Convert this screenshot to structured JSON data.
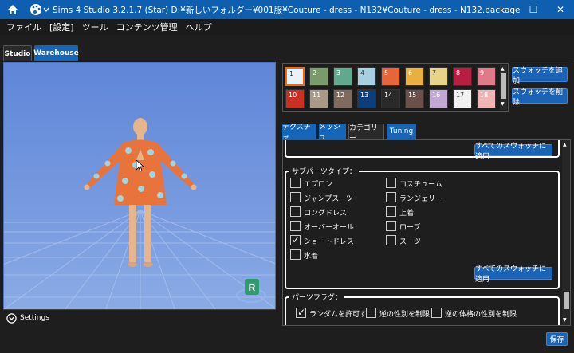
{
  "window": {
    "title": "Sims 4 Studio 3.2.1.7 (Star)  D:¥新しいフォルダー¥001服¥Couture - dress - N132¥Couture - dress - N132.package",
    "min_glyph": "—",
    "max_glyph": "☐",
    "close_glyph": "✕"
  },
  "menu": [
    "ファイル",
    "[設定]",
    "ツール",
    "コンテンツ管理",
    "ヘルプ"
  ],
  "main_tabs": [
    "Studio",
    "Warehouse"
  ],
  "swatches": [
    {
      "label": "1",
      "color": "#e8f2f8"
    },
    {
      "label": "2",
      "color": "#7a9a6a"
    },
    {
      "label": "3",
      "color": "#62a88e"
    },
    {
      "label": "4",
      "color": "#a8cfe0"
    },
    {
      "label": "5",
      "color": "#e8643a"
    },
    {
      "label": "6",
      "color": "#e8b040"
    },
    {
      "label": "7",
      "color": "#e8d38a"
    },
    {
      "label": "8",
      "color": "#b81e42"
    },
    {
      "label": "9",
      "color": "#e07a8a"
    },
    {
      "label": "10",
      "color": "#c83024"
    },
    {
      "label": "11",
      "color": "#a89a86"
    },
    {
      "label": "12",
      "color": "#7e6a5e"
    },
    {
      "label": "13",
      "color": "#0e3e78"
    },
    {
      "label": "14",
      "color": "#2a2a2a"
    },
    {
      "label": "15",
      "color": "#6a5048"
    },
    {
      "label": "16",
      "color": "#c2a6d4"
    },
    {
      "label": "17",
      "color": "#f2f2f2"
    },
    {
      "label": "18",
      "color": "#f0b4b4"
    }
  ],
  "swatch_buttons": {
    "add": "スウォッチを追加",
    "delete": "スウォッチを削除"
  },
  "sub_tabs": [
    "テクスチャ",
    "メッシュ",
    "カテゴリー",
    "Tuning"
  ],
  "apply_all": "すべてのスウォッチに適用",
  "subparts": {
    "title": "サブパーツタイプ：",
    "left": [
      {
        "label": "エプロン",
        "checked": false
      },
      {
        "label": "ジャンプスーツ",
        "checked": false
      },
      {
        "label": "ロングドレス",
        "checked": false
      },
      {
        "label": "オーバーオール",
        "checked": false
      },
      {
        "label": "ショートドレス",
        "checked": true
      },
      {
        "label": "水着",
        "checked": false
      }
    ],
    "right": [
      {
        "label": "コスチューム",
        "checked": false
      },
      {
        "label": "ランジェリー",
        "checked": false
      },
      {
        "label": "上着",
        "checked": false
      },
      {
        "label": "ローブ",
        "checked": false
      },
      {
        "label": "スーツ",
        "checked": false
      }
    ]
  },
  "flags": {
    "title": "パーツフラグ：",
    "items": [
      {
        "label": "ランダムを許可する",
        "checked": true
      },
      {
        "label": "逆の性別を制限",
        "checked": false
      },
      {
        "label": "逆の体格の性別を制限",
        "checked": false
      }
    ]
  },
  "settings_label": "Settings",
  "settings_icon": "chevron-down-circle-icon",
  "r_badge": "R",
  "save": "保存"
}
